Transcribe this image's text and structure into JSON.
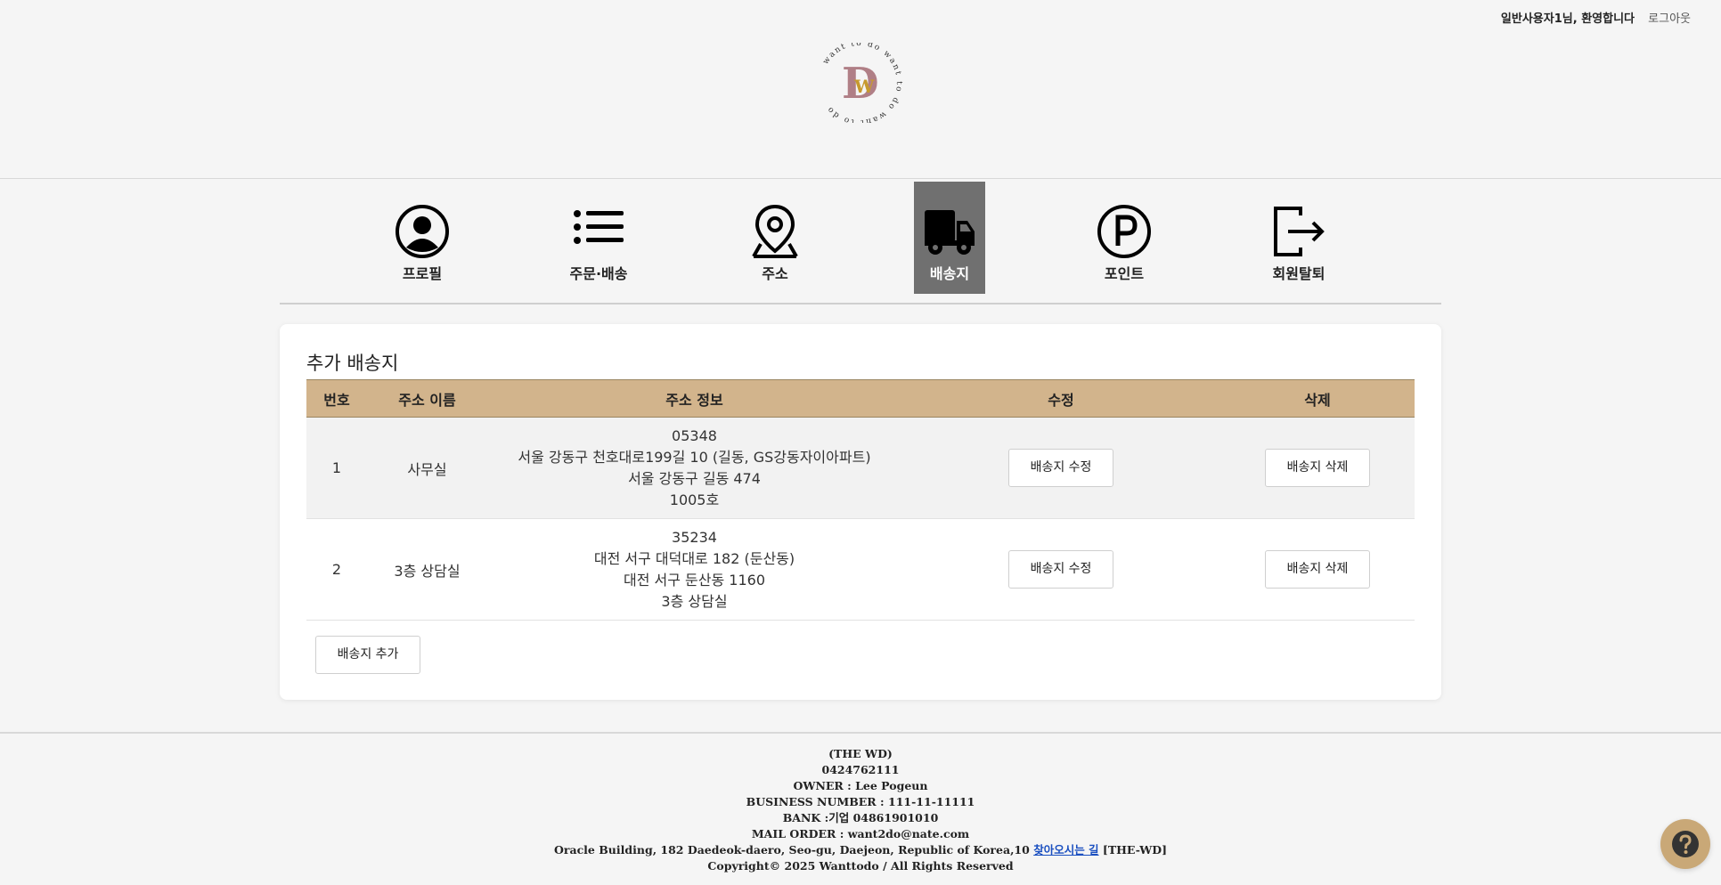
{
  "header": {
    "greeting": "일반사용자1님, 환영합니다",
    "logout": "로그아웃",
    "logo_text": "want to do want to do want to do",
    "logo_letters": "DW"
  },
  "nav": {
    "items": [
      {
        "label": "프로필",
        "icon": "profile-icon"
      },
      {
        "label": "주문·배송",
        "icon": "list-icon"
      },
      {
        "label": "주소",
        "icon": "map-pin-icon"
      },
      {
        "label": "배송지",
        "icon": "truck-icon",
        "active": true
      },
      {
        "label": "포인트",
        "icon": "point-icon"
      },
      {
        "label": "회원탈퇴",
        "icon": "logout-arrow-icon"
      }
    ]
  },
  "section": {
    "title": "추가 배송지",
    "columns": [
      "번호",
      "주소 이름",
      "주소 정보",
      "수정",
      "삭제"
    ],
    "rows": [
      {
        "no": "1",
        "name": "사무실",
        "zip": "05348",
        "road": "서울 강동구 천호대로199길 10 (길동, GS강동자이아파트)",
        "jibun": "서울 강동구 길동 474",
        "detail": "1005호",
        "edit": "배송지 수정",
        "delete": "배송지 삭제"
      },
      {
        "no": "2",
        "name": "3층 상담실",
        "zip": "35234",
        "road": "대전 서구 대덕대로 182 (둔산동)",
        "jibun": "대전 서구 둔산동 1160",
        "detail": "3층 상담실",
        "edit": "배송지 수정",
        "delete": "배송지 삭제"
      }
    ],
    "add_button": "배송지 추가"
  },
  "footer": {
    "company": "(THE WD)",
    "phone": "0424762111",
    "owner": "OWNER : Lee Pogeun",
    "business": "BUSINESS NUMBER : 111-11-11111",
    "bank": "BANK :기업 04861901010",
    "mail": "MAIL ORDER : want2do@nate.com",
    "address": "Oracle Building, 182 Daedeok-daero, Seo-gu, Daejeon, Republic of Korea,10",
    "directions_link": "찾아오시는 길",
    "brand_tag": "[THE-WD]",
    "copyright": "Copyright© 2025 Wanttodo / All Rights Reserved"
  },
  "colors": {
    "table_header": "#d2b48c",
    "active_nav": "#707070",
    "help_button": "#c9a877",
    "logo_d": "#b07f86",
    "logo_w": "#c79a2e"
  }
}
